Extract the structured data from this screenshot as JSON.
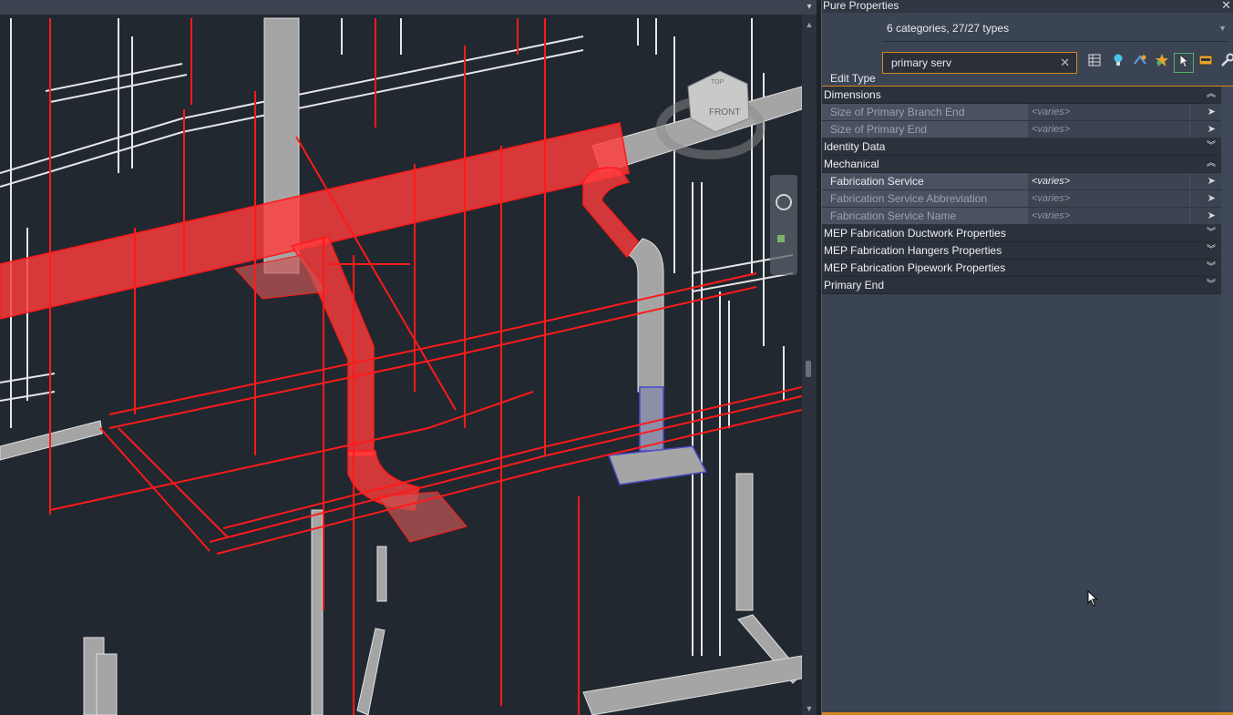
{
  "panel": {
    "title": "Pure Properties",
    "close": "✕",
    "filter_label": "6 categories, 27/27 types",
    "search_value": "primary serv",
    "search_clear": "✕",
    "edit_type_label": "Edit Type",
    "toolbar": [
      "table-list-icon",
      "lightbulb-icon",
      "select-fx-icon",
      "star-icon",
      "select-pointer-icon",
      "panel-icon",
      "wrench-icon"
    ]
  },
  "categories": [
    {
      "name": "Dimensions",
      "expanded": true,
      "rows": [
        {
          "name": "Size of Primary Branch End",
          "value": "<varies>"
        },
        {
          "name": "Size of Primary End",
          "value": "<varies>"
        }
      ]
    },
    {
      "name": "Identity Data",
      "expanded": false,
      "rows": []
    },
    {
      "name": "Mechanical",
      "expanded": true,
      "rows": [
        {
          "name": "Fabrication Service",
          "value": "<varies>"
        },
        {
          "name": "Fabrication Service Abbreviation",
          "value": "<varies>"
        },
        {
          "name": "Fabrication Service Name",
          "value": "<varies>"
        }
      ]
    },
    {
      "name": "MEP Fabrication Ductwork Properties",
      "expanded": false,
      "rows": []
    },
    {
      "name": "MEP Fabrication Hangers Properties",
      "expanded": false,
      "rows": []
    },
    {
      "name": "MEP Fabrication Pipework Properties",
      "expanded": false,
      "rows": []
    },
    {
      "name": "Primary End",
      "expanded": false,
      "rows": []
    }
  ],
  "viewcube": {
    "label": "FRONT",
    "corner_label": "TOP"
  },
  "colors": {
    "accent": "#d4871f",
    "selection": "#ff2a2a",
    "viewport_bg": "#212830"
  }
}
